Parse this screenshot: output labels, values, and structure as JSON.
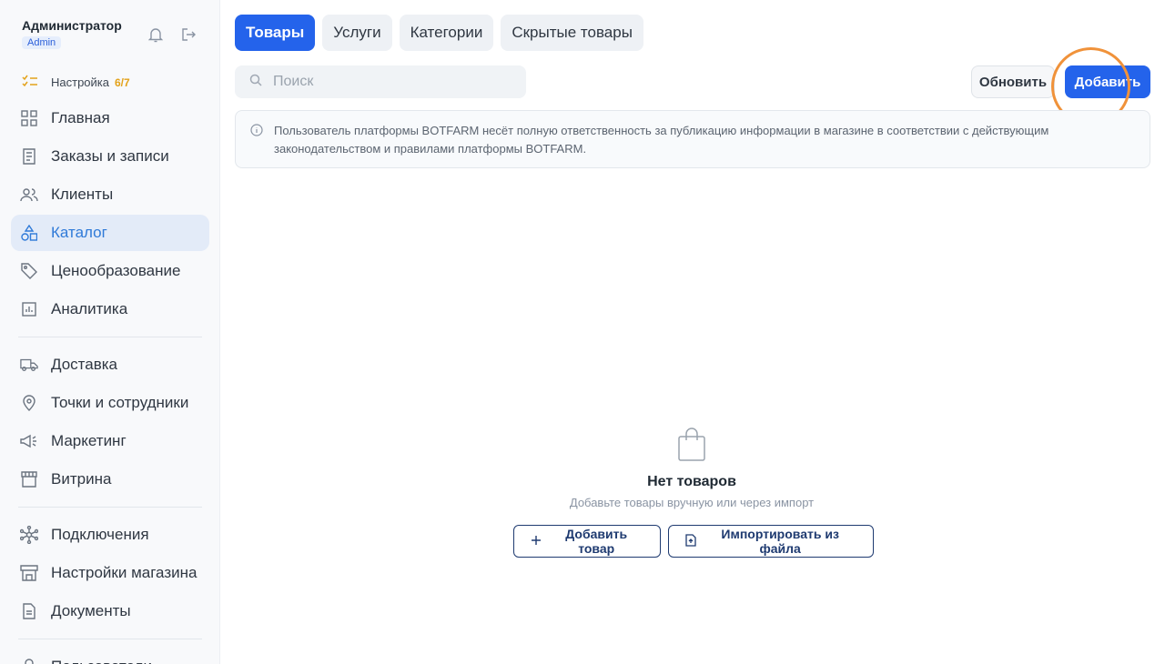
{
  "user": {
    "name": "Администратор",
    "role": "Admin"
  },
  "setup": {
    "label": "Настройка",
    "count": "6/7"
  },
  "nav_groups": [
    [
      {
        "label": "Главная",
        "icon": "grid-icon"
      },
      {
        "label": "Заказы и записи",
        "icon": "receipt-icon"
      },
      {
        "label": "Клиенты",
        "icon": "users-icon"
      },
      {
        "label": "Каталог",
        "icon": "shapes-icon",
        "active": true
      },
      {
        "label": "Ценообразование",
        "icon": "tag-icon"
      },
      {
        "label": "Аналитика",
        "icon": "chart-icon"
      }
    ],
    [
      {
        "label": "Доставка",
        "icon": "truck-icon"
      },
      {
        "label": "Точки и сотрудники",
        "icon": "location-pin-icon"
      },
      {
        "label": "Маркетинг",
        "icon": "megaphone-icon"
      },
      {
        "label": "Витрина",
        "icon": "storefront-icon"
      }
    ],
    [
      {
        "label": "Подключения",
        "icon": "network-icon"
      },
      {
        "label": "Настройки магазина",
        "icon": "shop-settings-icon"
      },
      {
        "label": "Документы",
        "icon": "document-icon"
      }
    ],
    [
      {
        "label": "Пользователи",
        "icon": "user-icon"
      }
    ]
  ],
  "tabs": [
    {
      "label": "Товары",
      "active": true
    },
    {
      "label": "Услуги"
    },
    {
      "label": "Категории"
    },
    {
      "label": "Скрытые товары"
    }
  ],
  "search": {
    "placeholder": "Поиск"
  },
  "toolbar": {
    "refresh_label": "Обновить",
    "add_label": "Добавить"
  },
  "notice": {
    "text": "Пользователь платформы BOTFARM несёт полную ответственность за публикацию информации в магазине в соответствии с действующим законодательством и правилами платформы BOTFARM."
  },
  "empty": {
    "title": "Нет товаров",
    "subtitle": "Добавьте товары вручную или через импорт",
    "add_label": "Добавить товар",
    "import_label": "Импортировать из файла"
  },
  "colors": {
    "accent": "#2463eb",
    "highlight": "#f0923a",
    "setup": "#e3a21a"
  }
}
